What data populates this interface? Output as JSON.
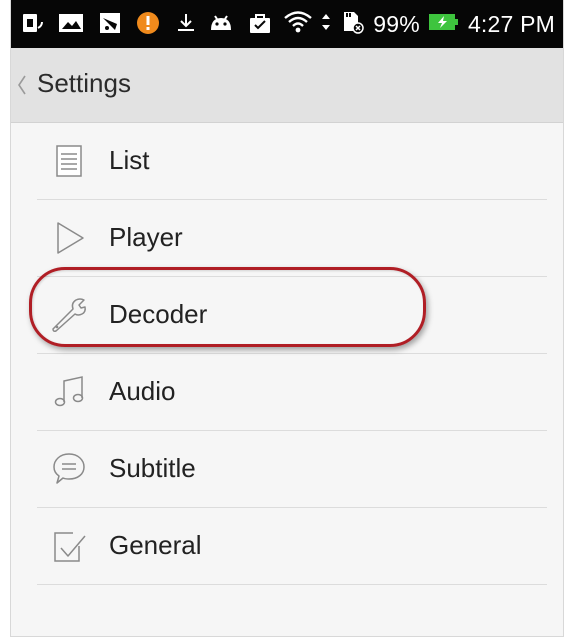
{
  "status_bar": {
    "battery": "99%",
    "time": "4:27 PM",
    "icons": [
      "sim-card-icon",
      "image-icon",
      "screenshot-icon",
      "warning-icon",
      "download-icon",
      "android-icon",
      "shopping-bag-icon",
      "wifi-icon",
      "data-transfer-icon",
      "sd-card-icon",
      "battery-charging-icon"
    ]
  },
  "app_bar": {
    "title": "Settings",
    "back_icon": "chevron-left-icon"
  },
  "menu": {
    "items": [
      {
        "label": "List",
        "icon": "list-icon"
      },
      {
        "label": "Player",
        "icon": "play-icon"
      },
      {
        "label": "Decoder",
        "icon": "wrench-icon"
      },
      {
        "label": "Audio",
        "icon": "music-note-icon"
      },
      {
        "label": "Subtitle",
        "icon": "chat-bubble-icon"
      },
      {
        "label": "General",
        "icon": "checkbox-icon"
      }
    ],
    "highlighted": "Decoder",
    "highlight_color": "#b01e25"
  }
}
